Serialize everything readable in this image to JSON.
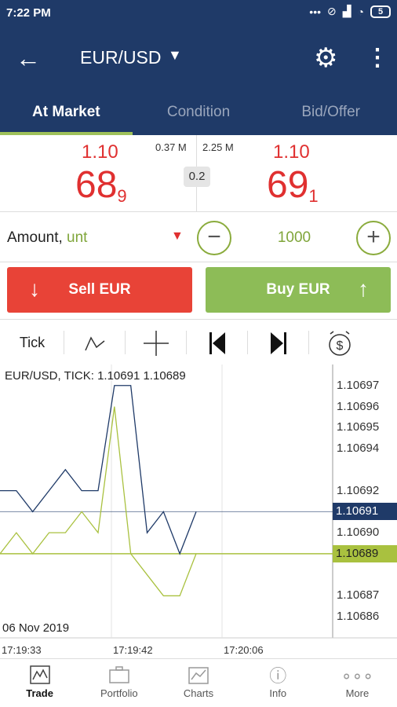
{
  "status": {
    "time": "7:22 PM",
    "battery": "5"
  },
  "appbar": {
    "title": "EUR/USD"
  },
  "tabs": [
    {
      "label": "At Market"
    },
    {
      "label": "Condition"
    },
    {
      "label": "Bid/Offer"
    }
  ],
  "quote": {
    "bid_prefix": "1.10",
    "bid_big": "68",
    "bid_pip": "9",
    "ask_prefix": "1.10",
    "ask_big": "69",
    "ask_pip": "1",
    "bid_volume": "0.37 M",
    "ask_volume": "2.25 M",
    "spread": "0.2"
  },
  "amount": {
    "label": "Amount,",
    "unit": "unt",
    "value": "1000"
  },
  "actions": {
    "sell": "Sell EUR",
    "buy": "Buy EUR"
  },
  "toolbar": {
    "tick_label": "Tick"
  },
  "chart_header": "EUR/USD, TICK: 1.10691 1.10689",
  "colors": {
    "bid": "#1f3a68",
    "ask": "#a9c13f",
    "sell": "#e84337",
    "buy": "#8dbc57",
    "header": "#1f3a68"
  },
  "chart_data": {
    "type": "line",
    "date": "06 Nov 2019",
    "x_ticks": [
      "17:19:33",
      "17:19:42",
      "17:20:06"
    ],
    "y_ticks": [
      "1.10697",
      "1.10696",
      "1.10695",
      "1.10694",
      "1.10692",
      "1.10690",
      "1.10687",
      "1.10686"
    ],
    "ylim": [
      1.10685,
      1.10698
    ],
    "current_bid": "1.10691",
    "current_ask": "1.10689",
    "series": [
      {
        "color": "#1f3a68",
        "values": [
          1.10692,
          1.10692,
          1.10691,
          1.10692,
          1.10693,
          1.10692,
          1.10692,
          1.10697,
          1.10697,
          1.1069,
          1.10691,
          1.10689,
          1.10691
        ]
      },
      {
        "color": "#a9c13f",
        "values": [
          1.10689,
          1.1069,
          1.10689,
          1.1069,
          1.1069,
          1.10691,
          1.1069,
          1.10696,
          1.10689,
          1.10688,
          1.10687,
          1.10687,
          1.10689
        ]
      }
    ]
  },
  "nav": [
    {
      "label": "Trade",
      "icon": "trade-icon"
    },
    {
      "label": "Portfolio",
      "icon": "portfolio-icon"
    },
    {
      "label": "Charts",
      "icon": "charts-icon"
    },
    {
      "label": "Info",
      "icon": "info-icon"
    },
    {
      "label": "More",
      "icon": "more-icon"
    }
  ]
}
